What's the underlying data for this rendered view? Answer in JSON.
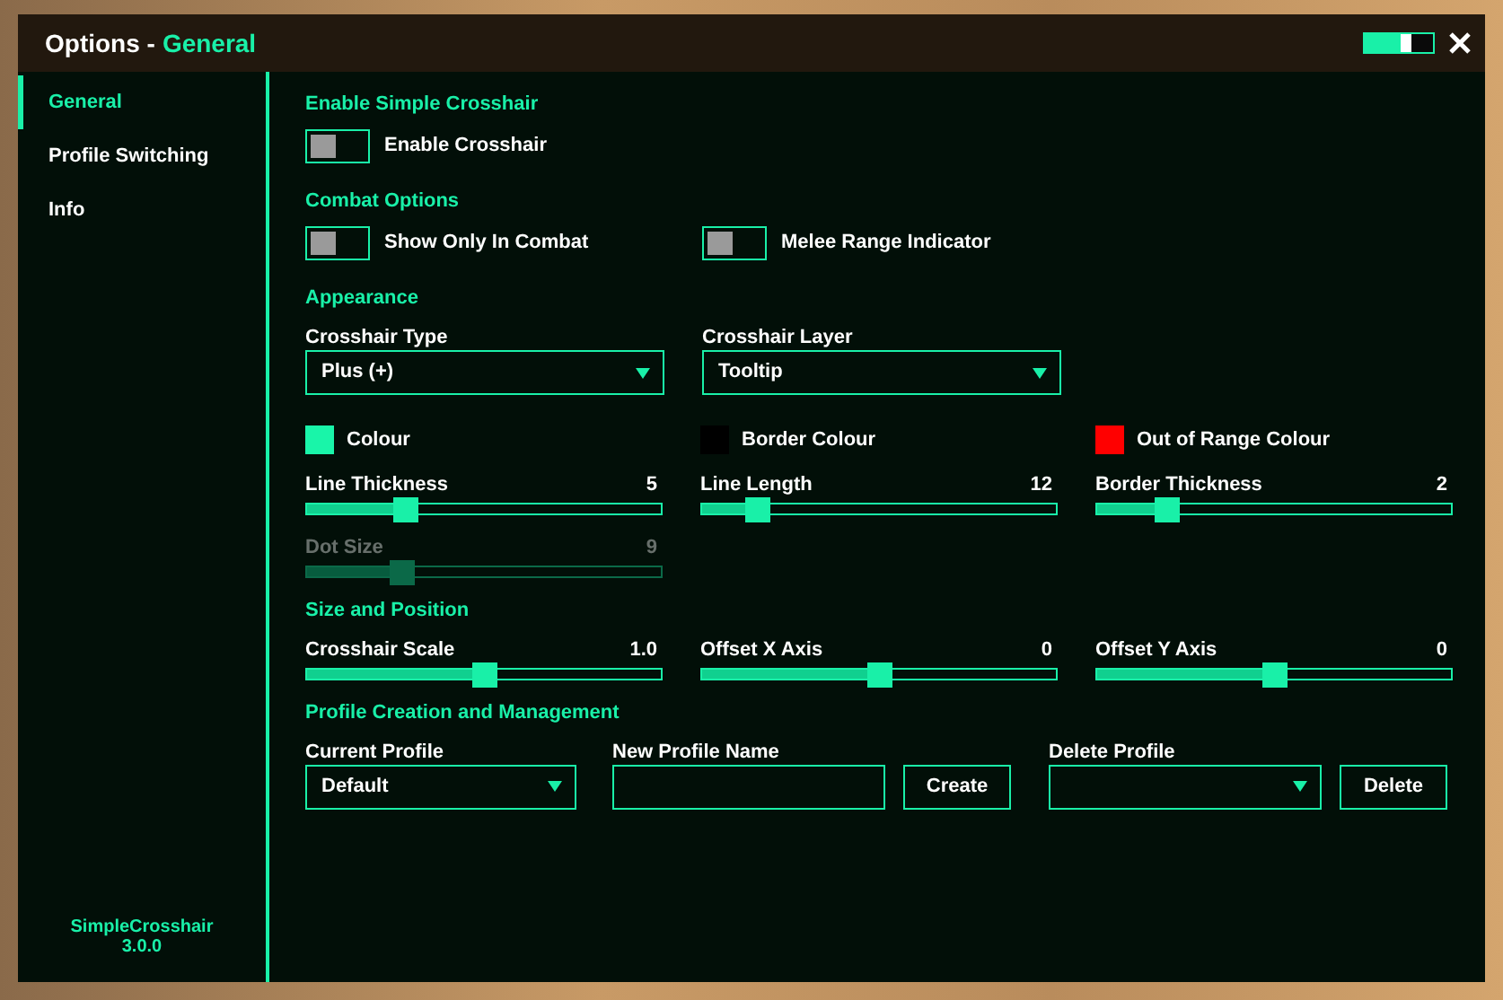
{
  "window": {
    "title": "Options -",
    "section": "General",
    "opacity_slider": {
      "level": 0.55
    }
  },
  "sidebar": {
    "items": [
      {
        "label": "General",
        "selected": true
      },
      {
        "label": "Profile Switching",
        "selected": false
      },
      {
        "label": "Info",
        "selected": false
      }
    ],
    "footer": [
      "SimpleCrosshair",
      "3.0.0"
    ]
  },
  "sections": [
    {
      "title": "Enable Simple Crosshair",
      "rows": [
        {
          "kind": "toggles",
          "items": [
            {
              "label": "Enable Crosshair",
              "on": false
            }
          ]
        }
      ]
    },
    {
      "title": "Combat Options",
      "rows": [
        {
          "kind": "toggles",
          "items": [
            {
              "label": "Show Only In Combat",
              "on": false
            },
            {
              "label": "Melee Range Indicator",
              "on": false
            }
          ]
        }
      ]
    },
    {
      "title": "Appearance",
      "rows": [
        {
          "kind": "dropdowns",
          "items": [
            {
              "label": "Crosshair Type",
              "value": "Plus (+)"
            },
            {
              "label": "Crosshair Layer",
              "value": "Tooltip"
            }
          ]
        },
        {
          "kind": "colours",
          "items": [
            {
              "label": "Colour",
              "color": "#19f5a9"
            },
            {
              "label": "Border Colour",
              "color": "#000000"
            },
            {
              "label": "Out of Range Colour",
              "color": "#ff0000"
            }
          ]
        },
        {
          "kind": "sliders",
          "items": [
            {
              "label": "Line Thickness",
              "reading": "5",
              "level": 0.28,
              "disabled": false
            },
            {
              "label": "Line Length",
              "reading": "12",
              "level": 0.16,
              "disabled": false
            },
            {
              "label": "Border Thickness",
              "reading": "2",
              "level": 0.2,
              "disabled": false
            }
          ]
        },
        {
          "kind": "sliders",
          "items": [
            {
              "label": "Dot Size",
              "reading": "9",
              "level": 0.27,
              "disabled": true
            }
          ]
        }
      ]
    },
    {
      "title": "Size and Position",
      "rows": [
        {
          "kind": "sliders",
          "items": [
            {
              "label": "Crosshair Scale",
              "reading": "1.0",
              "level": 0.5,
              "disabled": false
            },
            {
              "label": "Offset X Axis",
              "reading": "0",
              "level": 0.5,
              "disabled": false
            },
            {
              "label": "Offset Y Axis",
              "reading": "0",
              "level": 0.5,
              "disabled": false
            }
          ]
        }
      ]
    },
    {
      "title": "Profile Creation and Management",
      "rows": [
        {
          "kind": "profile",
          "current": {
            "label": "Current Profile",
            "value": "Default"
          },
          "new_name": {
            "label": "New Profile Name"
          },
          "create_button": "Create",
          "delete": {
            "label": "Delete Profile"
          },
          "delete_button": "Delete"
        }
      ]
    }
  ]
}
